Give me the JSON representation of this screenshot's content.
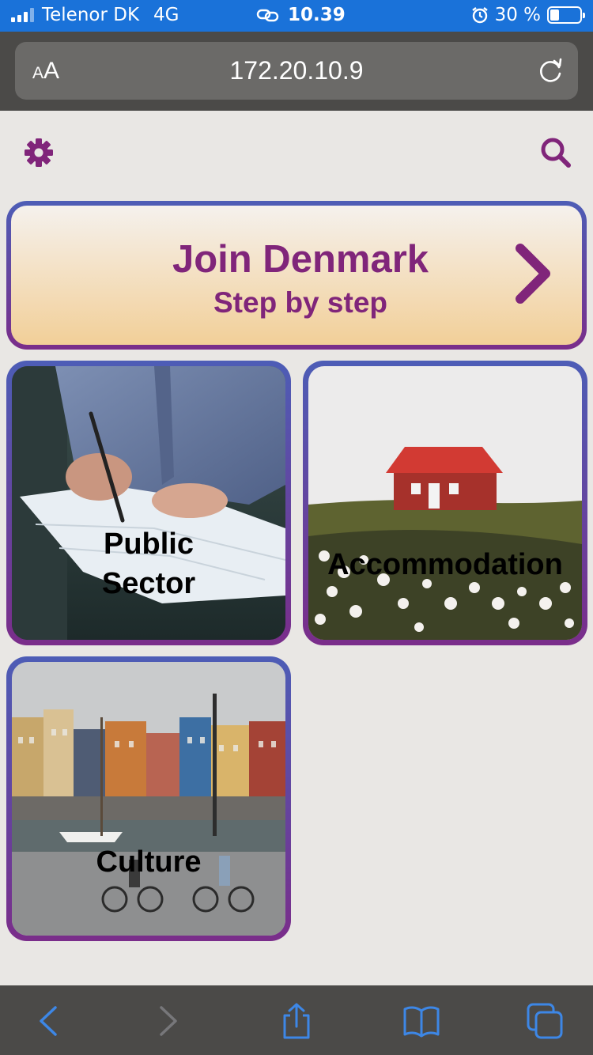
{
  "status_bar": {
    "carrier": "Telenor DK",
    "network": "4G",
    "time": "10.39",
    "battery_text": "30 %",
    "battery_level": 0.3
  },
  "browser": {
    "text_size_label_small": "A",
    "text_size_label_large": "A",
    "url": "172.20.10.9"
  },
  "hero": {
    "title": "Join Denmark",
    "subtitle": "Step by step"
  },
  "tiles": [
    {
      "label": "Public\nSector",
      "image": "person-signing-document-photo"
    },
    {
      "label": "Accommodation",
      "image": "red-house-on-hill-photo"
    },
    {
      "label": "Culture",
      "image": "nyhavn-harbour-cyclists-photo"
    }
  ],
  "colors": {
    "accent": "#80257a",
    "border_top": "#4d5db6",
    "border_bottom": "#7a2d8a",
    "status_bar": "#1a72d9",
    "browser_chrome": "#4b4a48",
    "toolbar_icon": "#3d87e6"
  }
}
